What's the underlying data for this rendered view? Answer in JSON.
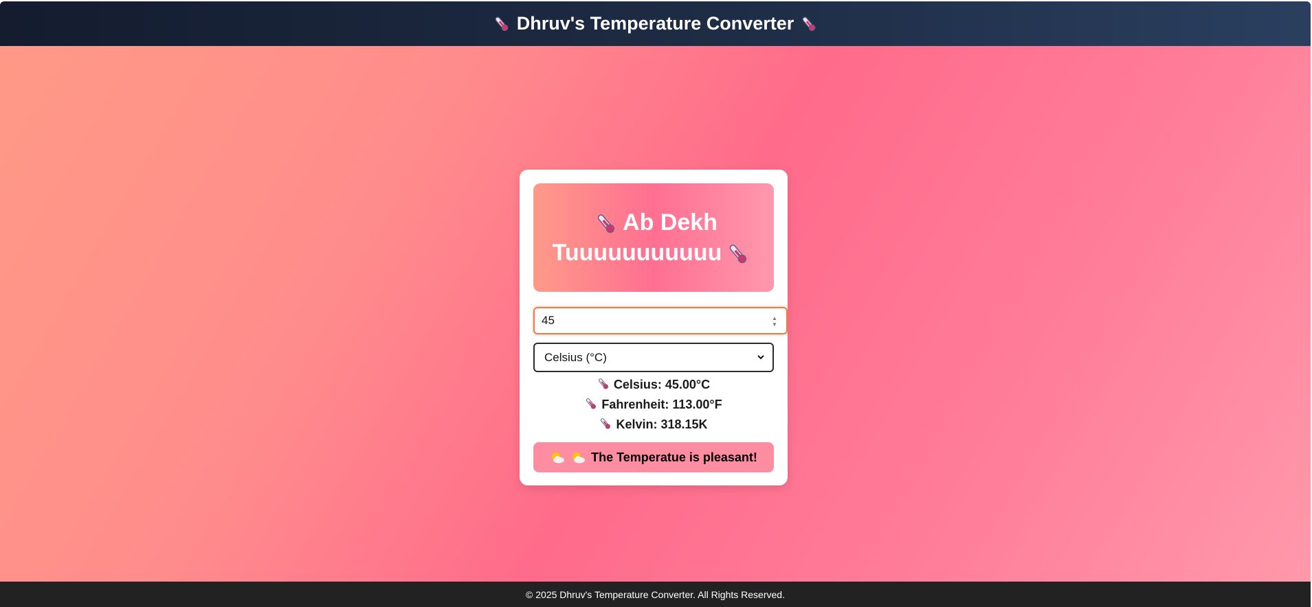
{
  "header": {
    "title": "Dhruv's Temperature Converter",
    "icon": "thermometer-icon"
  },
  "card": {
    "banner_line1": "Ab Dekh",
    "banner_line2": "Tuuuuuuuuuuu",
    "input": {
      "value": "45"
    },
    "unit_select": {
      "selected": "Celsius (°C)"
    },
    "results": {
      "celsius": "Celsius: 45.00°C",
      "fahrenheit": "Fahrenheit: 113.00°F",
      "kelvin": "Kelvin: 318.15K"
    },
    "status": {
      "icon": "sun-behind-cloud-icon",
      "text": "The Temperatue is pleasant!"
    }
  },
  "footer": {
    "text": "© 2025 Dhruv's Temperature Converter. All Rights Reserved."
  },
  "colors": {
    "header_bg": "#1e2c45",
    "card_bg": "#ffffff",
    "status_bg": "#ff8da2",
    "footer_bg": "#222222",
    "input_border": "#f0794c"
  }
}
